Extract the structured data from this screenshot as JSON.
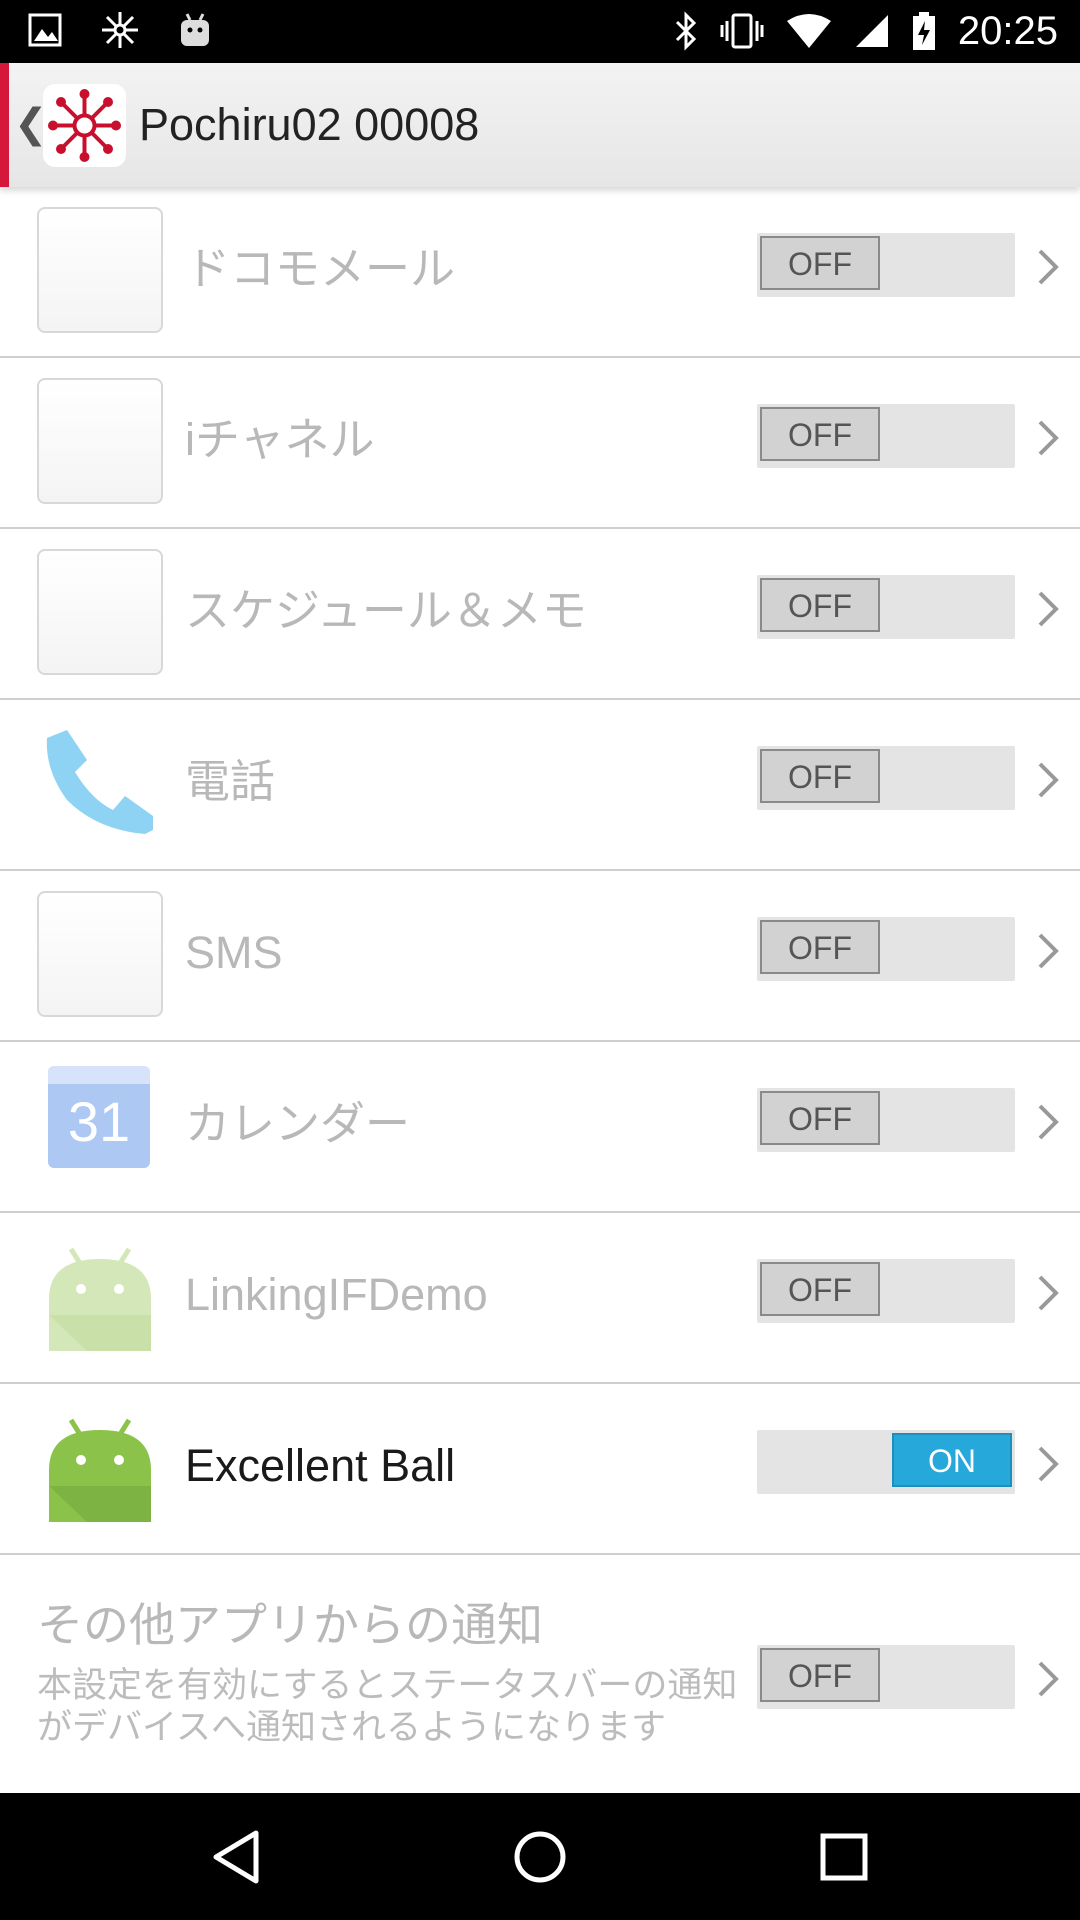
{
  "status_bar": {
    "time": "20:25",
    "left_icons": [
      "image-icon",
      "network-icon",
      "android-icon"
    ],
    "right_icons": [
      "bluetooth-icon",
      "vibrate-icon",
      "wifi-icon",
      "signal-icon",
      "battery-icon"
    ]
  },
  "action_bar": {
    "back_glyph": "❮",
    "title": "Pochiru02 00008",
    "accent_color": "#d4173a"
  },
  "rows": [
    {
      "label": "ドコモメール",
      "icon": "placeholder-icon",
      "toggle": "OFF"
    },
    {
      "label": "iチャネル",
      "icon": "placeholder-icon",
      "toggle": "OFF"
    },
    {
      "label": "スケジュール＆メモ",
      "icon": "placeholder-icon",
      "toggle": "OFF"
    },
    {
      "label": "電話",
      "icon": "phone-icon",
      "toggle": "OFF"
    },
    {
      "label": "SMS",
      "icon": "placeholder-icon",
      "toggle": "OFF"
    },
    {
      "label": "カレンダー",
      "icon": "calendar-icon",
      "calendar_day": "31",
      "toggle": "OFF"
    },
    {
      "label": "LinkingIFDemo",
      "icon": "android-app-icon",
      "toggle": "OFF"
    },
    {
      "label": "Excellent Ball",
      "icon": "android-app-icon",
      "toggle": "ON"
    }
  ],
  "other_notifications": {
    "title": "その他アプリからの通知",
    "description": "本設定を有効にするとステータスバーの通知がデバイスへ通知されるようになります",
    "toggle": "OFF"
  },
  "colors": {
    "toggle_on": "#27a8da",
    "disabled_text": "#b8b8b8"
  },
  "nav_bar": {
    "buttons": [
      "back-icon",
      "home-icon",
      "recents-icon"
    ]
  }
}
